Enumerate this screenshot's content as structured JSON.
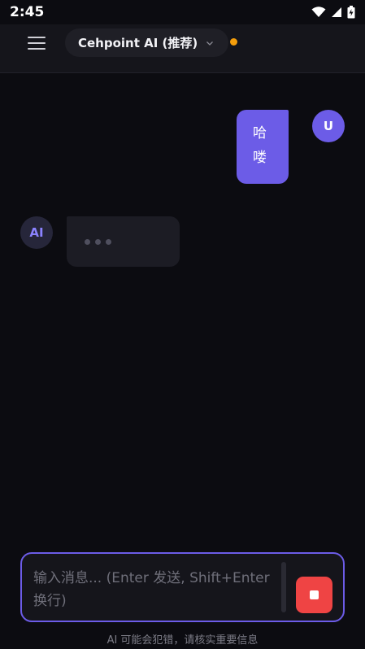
{
  "statusbar": {
    "time": "2:45"
  },
  "header": {
    "model_name": "Cehpoint AI (推荐)",
    "status_color": "#f59e0b"
  },
  "messages": [
    {
      "role": "user",
      "avatar_label": "U",
      "text_lines": [
        "哈",
        "喽"
      ]
    },
    {
      "role": "assistant",
      "avatar_label": "AI",
      "state": "typing"
    }
  ],
  "composer": {
    "placeholder": "输入消息... (Enter 发送, Shift+Enter 换行)",
    "stop_icon": "stop-icon"
  },
  "footer": {
    "disclaimer": "AI 可能会犯错，请核实重要信息"
  },
  "colors": {
    "accent": "#6c5ce7",
    "stop": "#ef4444",
    "background": "#0c0c11"
  }
}
